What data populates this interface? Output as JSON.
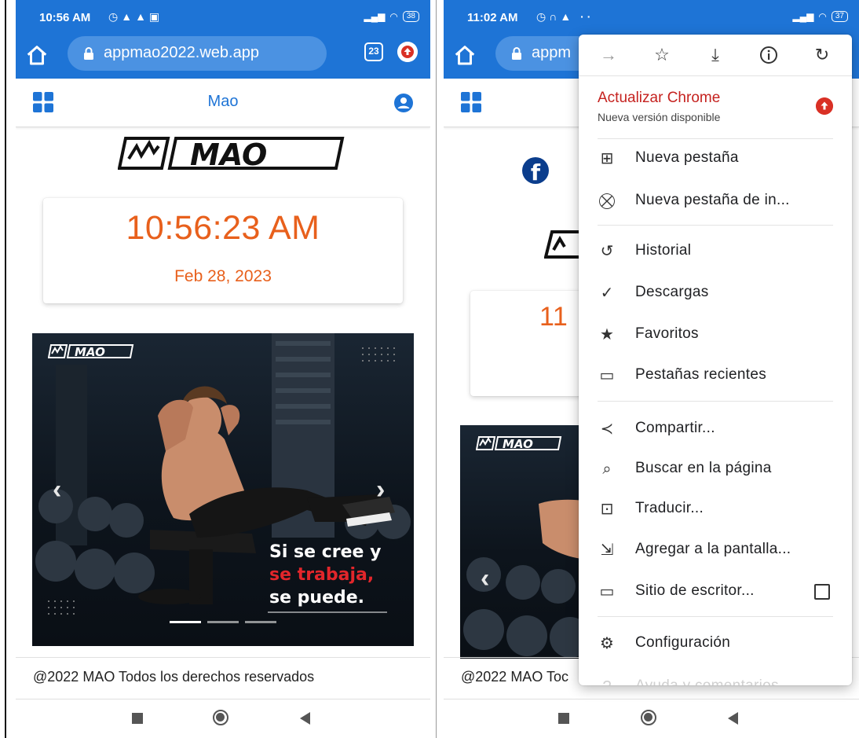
{
  "left": {
    "status": {
      "time": "10:56 AM",
      "battery": "38"
    },
    "browser": {
      "url": "appmao2022.web.app",
      "tab_count": "23"
    },
    "header": {
      "title": "Mao"
    },
    "logo": "MAO",
    "clock": {
      "time": "10:56:23 AM",
      "date": "Feb 28, 2023"
    },
    "banner": {
      "line1": "Si se cree y",
      "line2": "se trabaja,",
      "line3": "se puede."
    },
    "footer": "@2022 MAO Todos los derechos reservados"
  },
  "right": {
    "status": {
      "time": "11:02 AM",
      "battery": "37"
    },
    "browser": {
      "url_partial": "appm"
    },
    "clock_partial": "11",
    "footer_partial": "@2022 MAO Toc",
    "menu": {
      "update_title": "Actualizar Chrome",
      "update_subtitle": "Nueva versión disponible",
      "items": [
        {
          "label": "Nueva pestaña",
          "icon": "plus-box-icon"
        },
        {
          "label": "Nueva pestaña de in...",
          "icon": "incognito-icon"
        },
        {
          "label": "Historial",
          "icon": "history-icon"
        },
        {
          "label": "Descargas",
          "icon": "download-check-icon"
        },
        {
          "label": "Favoritos",
          "icon": "star-icon"
        },
        {
          "label": "Pestañas recientes",
          "icon": "devices-icon"
        },
        {
          "label": "Compartir...",
          "icon": "share-icon"
        },
        {
          "label": "Buscar en la página",
          "icon": "find-icon"
        },
        {
          "label": "Traducir...",
          "icon": "translate-icon"
        },
        {
          "label": "Agregar a la pantalla...",
          "icon": "add-home-icon"
        },
        {
          "label": "Sitio de escritor...",
          "icon": "desktop-icon"
        },
        {
          "label": "Configuración",
          "icon": "gear-icon"
        },
        {
          "label": "Ayuda y comentarios",
          "icon": "help-icon"
        }
      ]
    }
  },
  "colors": {
    "browser_blue": "#1e74d6",
    "accent_orange": "#e8601c",
    "update_red": "#c5221f"
  }
}
